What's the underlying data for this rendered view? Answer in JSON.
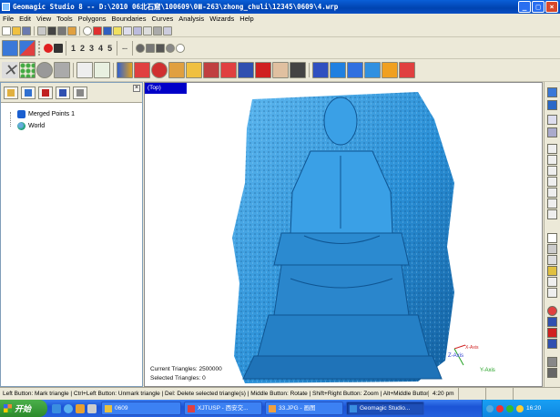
{
  "window": {
    "title": "Geomagic Studio 8 -- D:\\2010 06北石窟\\100609\\0Ⅲ-263\\zhong_chuli\\12345\\0609\\4.wrp"
  },
  "menu": [
    "File",
    "Edit",
    "View",
    "Tools",
    "Polygons",
    "Boundaries",
    "Curves",
    "Analysis",
    "Wizards",
    "Help"
  ],
  "toolbar": {
    "numbers": [
      "1",
      "2",
      "3",
      "4",
      "5"
    ],
    "more": "..."
  },
  "tree": {
    "nodes": [
      "Merged Points 1",
      "World"
    ]
  },
  "viewport": {
    "view_label": "(Top)",
    "current_triangles": "Current Triangles: 2500000",
    "selected_triangles": "Selected Triangles: 0",
    "z_axis": "Z-Axis",
    "x_axis": "X-Axis",
    "y_axis": "Y-Axis"
  },
  "statusbar": {
    "message": "Left Button: Mark triangle | Ctrl+Left Button: Unmark triangle | Del: Delete selected triangle(s) | Middle Button: Rotate | Shift+Right Button: Zoom | Alt+Middle Button: Pa",
    "time": "4:20 pm"
  },
  "taskbar": {
    "start": "开始",
    "tasks": [
      "0609",
      "XJTUSP - 西安交...",
      "33.JPG - 画图",
      "Geomagic Studio..."
    ],
    "clock": "16:20"
  },
  "colors": {
    "model": "#2a8fd6",
    "titlebar": "#0a4fc4",
    "taskbar": "#1b54d6",
    "viewtag": "#0000c8"
  }
}
